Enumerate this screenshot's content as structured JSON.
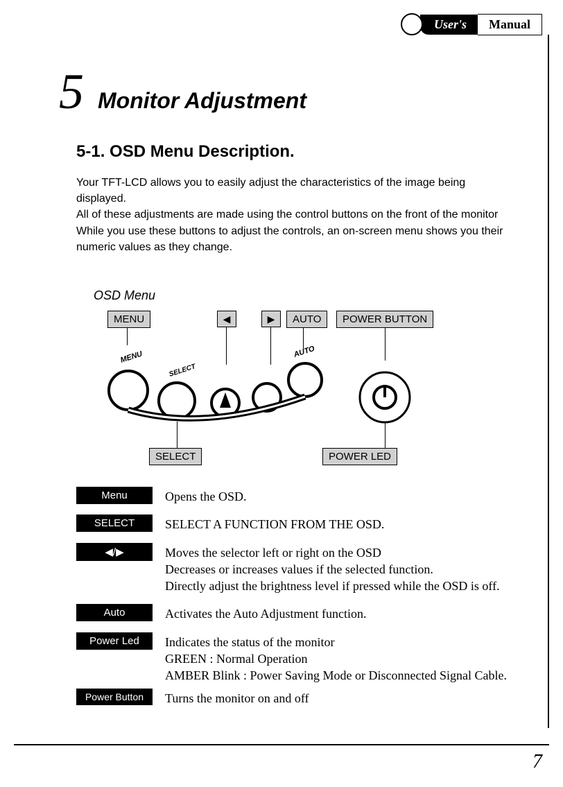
{
  "header": {
    "tab1": "User's",
    "tab2": "Manual"
  },
  "chapter": {
    "number": "5",
    "title": "Monitor Adjustment"
  },
  "section": {
    "title": "5-1.  OSD Menu Description."
  },
  "intro": {
    "p1": "Your TFT-LCD allows you to easily adjust the characteristics of the image being displayed.",
    "p2": "All of these adjustments are made using the control buttons on the front of the monitor",
    "p3": "While you use these buttons to adjust the controls, an on-screen menu shows you their numeric values as they change."
  },
  "osd_label": "OSD Menu",
  "diagram": {
    "menu": "MENU",
    "left": "◀",
    "right": "▶",
    "auto": "AUTO",
    "power_button": "POWER BUTTON",
    "select": "SELECT",
    "power_led": "POWER LED",
    "panel_menu": "MENU",
    "panel_select": "SELECT",
    "panel_auto": "AUTO"
  },
  "definitions": [
    {
      "label": "Menu",
      "desc": "Opens the OSD."
    },
    {
      "label": "SELECT",
      "desc": "SELECT A FUNCTION FROM THE OSD."
    },
    {
      "label": "◀/▶",
      "desc": "Moves the selector left or right on the OSD\nDecreases or increases  values if the selected function.\nDirectly adjust the brightness level if pressed while the OSD is off."
    },
    {
      "label": "Auto",
      "desc": "Activates the Auto Adjustment function."
    },
    {
      "label": "Power Led",
      "desc": "Indicates the status of the monitor\nGREEN : Normal Operation\nAMBER Blink : Power Saving Mode or Disconnected Signal Cable."
    },
    {
      "label": "Power Button",
      "desc": "Turns the monitor on and off"
    }
  ],
  "page_number": "7"
}
